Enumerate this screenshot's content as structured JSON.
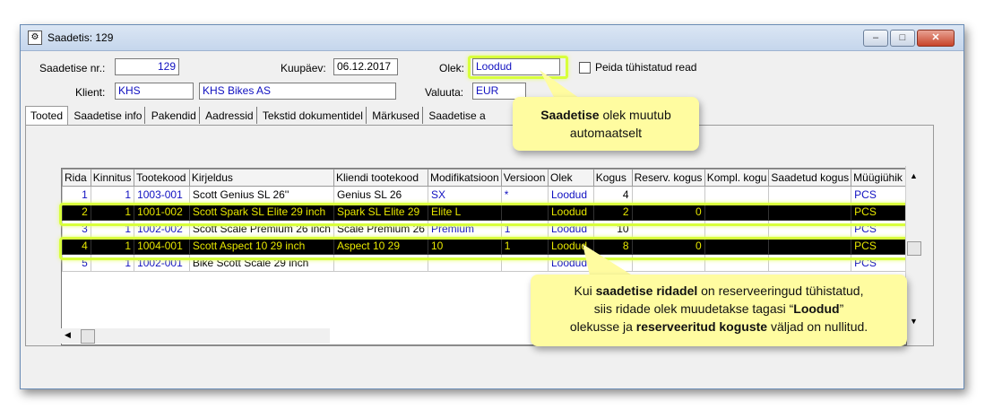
{
  "window": {
    "title": "Saadetis: 129",
    "buttons": {
      "min": "–",
      "max": "□",
      "close": "✕"
    }
  },
  "form": {
    "saadetise_nr_label": "Saadetise nr.:",
    "saadetise_nr": "129",
    "kuupaev_label": "Kuupäev:",
    "kuupaev": "06.12.2017",
    "olek_label": "Olek:",
    "olek": "Loodud",
    "peida_label": "Peida tühistatud read",
    "klient_label": "Klient:",
    "klient_code": "KHS",
    "klient_name": "KHS Bikes AS",
    "valuuta_label": "Valuuta:",
    "valuuta": "EUR"
  },
  "tabs": [
    "Tooted",
    "Saadetise info",
    "Pakendid",
    "Aadressid",
    "Tekstid dokumentidel",
    "Märkused",
    "Saadetise a"
  ],
  "table": {
    "headers": [
      "Rida",
      "Kinnitus",
      "Tootekood",
      "Kirjeldus",
      "Kliendi tootekood",
      "Modifikatsioon",
      "Versioon",
      "Olek",
      "Kogus",
      "Reserv. kogus",
      "Kompl. kogu",
      "Saadetud kogus",
      "Müügiühik"
    ],
    "rows": [
      [
        "1",
        "1",
        "1003-001",
        "Scott Genius SL 26''",
        "Genius SL 26",
        "SX",
        "*",
        "Loodud",
        "4",
        "",
        "",
        "",
        "PCS"
      ],
      [
        "2",
        "1",
        "1001-002",
        "Scott Spark SL Elite 29 inch",
        "Spark SL Elite 29",
        "Elite L",
        "",
        "Loodud",
        "2",
        "0",
        "",
        "",
        "PCS"
      ],
      [
        "3",
        "1",
        "1002-002",
        "Scott Scale Premium 26 inch",
        "Scale Premium 26",
        "Premium",
        "1",
        "Loodud",
        "10",
        "",
        "",
        "",
        "PCS"
      ],
      [
        "4",
        "1",
        "1004-001",
        "Scott Aspect 10 29 inch",
        "Aspect 10 29",
        "10",
        "1",
        "Loodud",
        "8",
        "0",
        "",
        "",
        "PCS"
      ],
      [
        "5",
        "1",
        "1002-001",
        "Bike Scott Scale 29 inch",
        "",
        "",
        "",
        "Loodud",
        "",
        "",
        "",
        "",
        "PCS"
      ]
    ],
    "dark_rows": [
      1,
      3
    ]
  },
  "callout1": {
    "bold": "Saadetise",
    "rest": " olek muutub",
    "line2": "automaatselt"
  },
  "callout2": {
    "l1a": "Kui ",
    "l1b": "saadetise ridadel",
    "l1c": " on reserveeringud tühistatud,",
    "l2a": "siis ridade olek muudetakse tagasi  “",
    "l2b": "Loodud",
    "l2c": "”",
    "l3a": "olekusse ja ",
    "l3b": "reserveeritud koguste",
    "l3c": " väljad on nullitud."
  },
  "colors": {
    "highlight": "#d8ff3c",
    "callout": "#fffca0",
    "link": "#1010c0",
    "dark_row_text": "#e6e600"
  }
}
